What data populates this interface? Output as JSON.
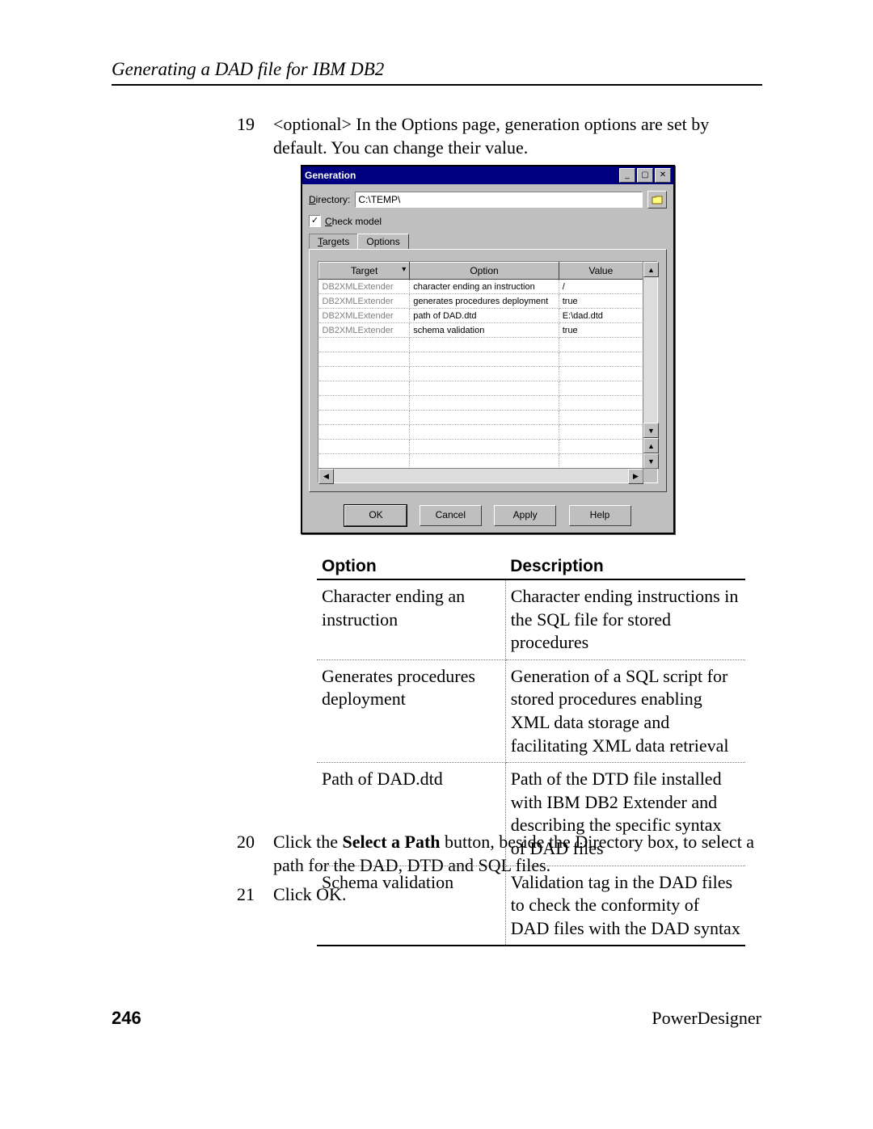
{
  "header": "Generating a DAD file for IBM DB2",
  "steps": {
    "s19": {
      "num": "19",
      "text": "<optional> In the Options page, generation options are set by default. You can change their value."
    },
    "s20": {
      "num": "20",
      "text_pre": "Click the ",
      "bold": "Select a Path",
      "text_post": " button, beside the Directory box, to select a path for the DAD, DTD and SQL files."
    },
    "s21": {
      "num": "21",
      "text": "Click OK."
    }
  },
  "dialog": {
    "title": "Generation",
    "directory": {
      "label_u": "D",
      "label_rest": "irectory:",
      "value": "C:\\TEMP\\"
    },
    "check": {
      "u_char": "C",
      "rest": "heck model",
      "checked": true
    },
    "tabs": {
      "targets": {
        "u": "T",
        "rest": "argets"
      },
      "options": "Options"
    },
    "grid": {
      "cols": {
        "h1": "Target",
        "h2": "Option",
        "h3": "Value"
      },
      "rows": [
        {
          "t": "DB2XMLExtender",
          "o": "character ending an instruction",
          "v": "/"
        },
        {
          "t": "DB2XMLExtender",
          "o": "generates procedures deployment",
          "v": "true"
        },
        {
          "t": "DB2XMLExtender",
          "o": "path of DAD.dtd",
          "v": "E:\\dad.dtd"
        },
        {
          "t": "DB2XMLExtender",
          "o": "schema validation",
          "v": "true"
        }
      ]
    },
    "buttons": {
      "ok": "OK",
      "cancel": "Cancel",
      "apply": "Apply",
      "help": "Help"
    }
  },
  "optionsTable": {
    "h1": "Option",
    "h2": "Description",
    "rows": [
      {
        "o": "Character ending an instruction",
        "d": "Character ending instructions in the SQL file for stored procedures"
      },
      {
        "o": "Generates procedures deployment",
        "d": "Generation of a SQL script for stored procedures enabling XML data storage and facilitating XML data retrieval"
      },
      {
        "o": "Path of DAD.dtd",
        "d": "Path of the DTD file installed with IBM DB2 Extender and describing the specific syntax of DAD files"
      },
      {
        "o": "Schema validation",
        "d": "Validation tag in the DAD files to check the conformity of DAD files with the DAD syntax"
      }
    ]
  },
  "footer": {
    "pagenum": "246",
    "product": "PowerDesigner"
  }
}
